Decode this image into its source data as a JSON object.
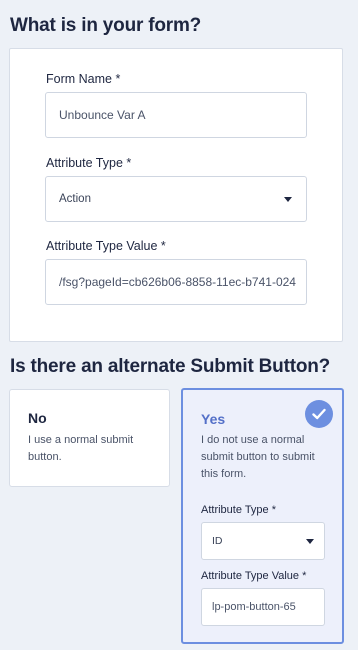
{
  "section1": {
    "title": "What is in your form?",
    "form_name": {
      "label": "Form Name *",
      "value": "Unbounce Var A"
    },
    "attribute_type": {
      "label": "Attribute Type *",
      "value": "Action"
    },
    "attribute_type_value": {
      "label": "Attribute Type Value *",
      "value": "/fsg?pageId=cb626b06-8858-11ec-b741-024"
    }
  },
  "section2": {
    "title": "Is there an alternate Submit Button?",
    "no_option": {
      "title": "No",
      "description": "I use a normal submit button."
    },
    "yes_option": {
      "title": "Yes",
      "description": "I do not use a normal submit button to submit this form.",
      "selected_icon": "checkmark-icon",
      "attribute_type": {
        "label": "Attribute Type *",
        "value": "ID"
      },
      "attribute_type_value": {
        "label": "Attribute Type Value *",
        "value": "lp-pom-button-65"
      }
    }
  },
  "colors": {
    "background": "#edf1f7",
    "accent": "#6d8fe0",
    "selected_bg": "#edf0fb",
    "selected_title": "#5470c8"
  }
}
